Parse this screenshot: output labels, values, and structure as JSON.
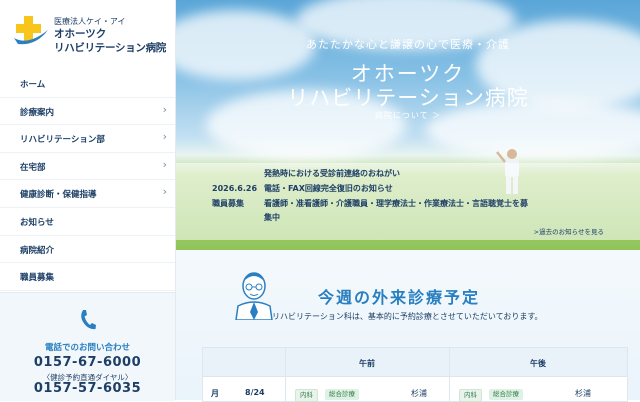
{
  "logo": {
    "corporation": "医療法人ケイ・アイ",
    "name_line1": "オホーツク",
    "name_line2": "リハビリテーション病院"
  },
  "nav": {
    "items": [
      {
        "label": "ホーム",
        "has_submenu": false
      },
      {
        "label": "診療案内",
        "has_submenu": true
      },
      {
        "label": "リハビリテーション部",
        "has_submenu": true
      },
      {
        "label": "在宅部",
        "has_submenu": true
      },
      {
        "label": "健康診断・保健指導",
        "has_submenu": true
      },
      {
        "label": "お知らせ",
        "has_submenu": false
      },
      {
        "label": "病院紹介",
        "has_submenu": false
      },
      {
        "label": "職員募集",
        "has_submenu": false
      }
    ],
    "chevron": "›"
  },
  "contact": {
    "title": "電話でのお問い合わせ",
    "tel": "0157-67-6000",
    "sub": "〈健診予約直通ダイヤル〉",
    "tel2": "0157-57-6035"
  },
  "hero": {
    "catch": "あたたかな心と謙譲の心で医療・介護",
    "title_line1": "オホーツク",
    "title_line2": "リハビリテーション病院",
    "about_link": "病院について ＞"
  },
  "news": {
    "date": "2026.6.26",
    "category": "職員募集",
    "items": [
      "発熱時における受診前連絡のおねがい",
      "電話・FAX回線完全復旧のお知らせ",
      "看護師・准看護師・介護職員・理学療法士・作業療法士・言語聴覚士を募",
      "集中"
    ],
    "more": ">過去のお知らせを見る"
  },
  "schedule": {
    "title": "今週の外来診療予定",
    "note": "リハビリテーション科は、基本的に予約診療とさせていただいております。",
    "col_am": "午前",
    "col_pm": "午後",
    "row": {
      "month": "月",
      "date": "8/24",
      "am_dept": "内科",
      "am_type": "総合診療",
      "am_doctor": "杉浦",
      "pm_dept": "内科",
      "pm_type": "総合診療",
      "pm_doctor": "杉浦"
    }
  },
  "colors": {
    "navy": "#1d3f66",
    "accent_blue": "#2a7fc0",
    "logo_yellow": "#f7c51b",
    "tag_green": "#2f7d46"
  }
}
